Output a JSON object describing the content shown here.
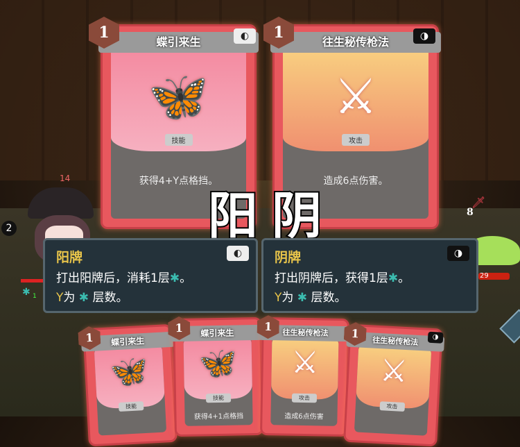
{
  "player": {
    "block": "2",
    "buff_count": "14",
    "power_count": "1"
  },
  "enemy": {
    "intent_damage": "8",
    "hp": "29"
  },
  "played_cards": [
    {
      "cost": "1",
      "name": "蝶引来生",
      "type": "技能",
      "desc": "获得4+Y点格挡。",
      "polarity": "yang",
      "icon": "butterfly-icon"
    },
    {
      "cost": "1",
      "name": "往生秘传枪法",
      "type": "攻击",
      "desc": "造成6点伤害。",
      "polarity": "yin",
      "icon": "spear-icon"
    }
  ],
  "labels": {
    "yang": "阳",
    "yin": "阴"
  },
  "tooltips": [
    {
      "title": "阳牌",
      "line1": "打出阳牌后，消耗1层",
      "line1_end": "。",
      "line2_y": "Y",
      "line2_a": "为",
      "line2_b": "层数。"
    },
    {
      "title": "阴牌",
      "line1": "打出阴牌后，获得1层",
      "line1_end": "。",
      "line2_y": "Y",
      "line2_a": "为",
      "line2_b": "层数。"
    }
  ],
  "hand": [
    {
      "cost": "1",
      "name": "蝶引来生",
      "type": "技能",
      "desc": ""
    },
    {
      "cost": "1",
      "name": "蝶引来生",
      "type": "技能",
      "desc": "获得4+1点格挡"
    },
    {
      "cost": "1",
      "name": "往生秘传枪法",
      "type": "攻击",
      "desc": "造成6点伤害"
    },
    {
      "cost": "1",
      "name": "往生秘传枪法",
      "type": "攻击",
      "desc": ""
    }
  ],
  "colors": {
    "accent": "#e9c54a",
    "card_border": "#e8585e",
    "tooltip_bg": "#24323a"
  }
}
